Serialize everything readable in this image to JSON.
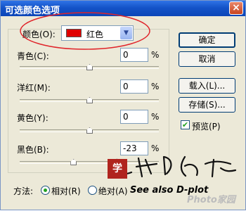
{
  "window": {
    "title": "可选颜色选项",
    "close_glyph": "×"
  },
  "color_select": {
    "label": "颜色(O):",
    "value": "红色",
    "swatch_color": "#e00000",
    "arrow": "▼"
  },
  "sliders": [
    {
      "label": "青色(C):",
      "value": "0",
      "unit": "%",
      "position": 0.5
    },
    {
      "label": "洋红(M):",
      "value": "0",
      "unit": "%",
      "position": 0.5
    },
    {
      "label": "黄色(Y):",
      "value": "0",
      "unit": "%",
      "position": 0.5
    },
    {
      "label": "黑色(B):",
      "value": "-23",
      "unit": "%",
      "position": 0.385
    }
  ],
  "buttons": {
    "ok": "确定",
    "cancel": "取消",
    "load": "载入(L)...",
    "save": "存储(S)..."
  },
  "preview": {
    "label": "预览(P)",
    "checked": true
  },
  "method": {
    "label": "方法:",
    "relative": "相对(R)",
    "absolute": "绝对(A)",
    "selected": "relative"
  },
  "annotation": {
    "handwriting": "See also D-plot",
    "circle_color": "#e0242a",
    "stamp_text": "学"
  },
  "watermark": {
    "text": "Photo家园"
  }
}
